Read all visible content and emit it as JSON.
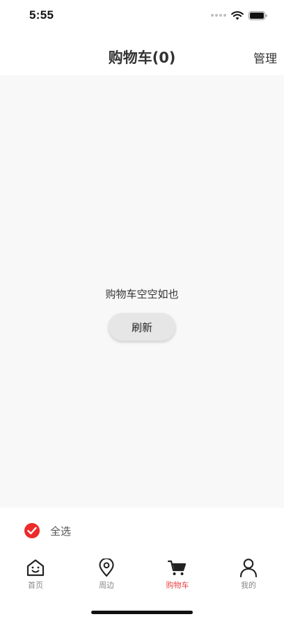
{
  "status": {
    "time": "5:55",
    "icons": [
      "signal-dots-icon",
      "wifi-icon",
      "battery-icon"
    ]
  },
  "header": {
    "title": "购物车(0)",
    "manage_label": "管理"
  },
  "empty_state": {
    "message": "购物车空空如也",
    "refresh_label": "刷新"
  },
  "select_all": {
    "label": "全选",
    "checked": true
  },
  "tabs": [
    {
      "label": "首页",
      "icon": "home-icon",
      "active": false
    },
    {
      "label": "周边",
      "icon": "location-pin-icon",
      "active": false
    },
    {
      "label": "购物车",
      "icon": "cart-icon",
      "active": true
    },
    {
      "label": "我的",
      "icon": "person-icon",
      "active": false
    }
  ],
  "colors": {
    "accent": "#ee2a2a",
    "active_tab": "#e94343",
    "background": "#f8f8f8"
  }
}
